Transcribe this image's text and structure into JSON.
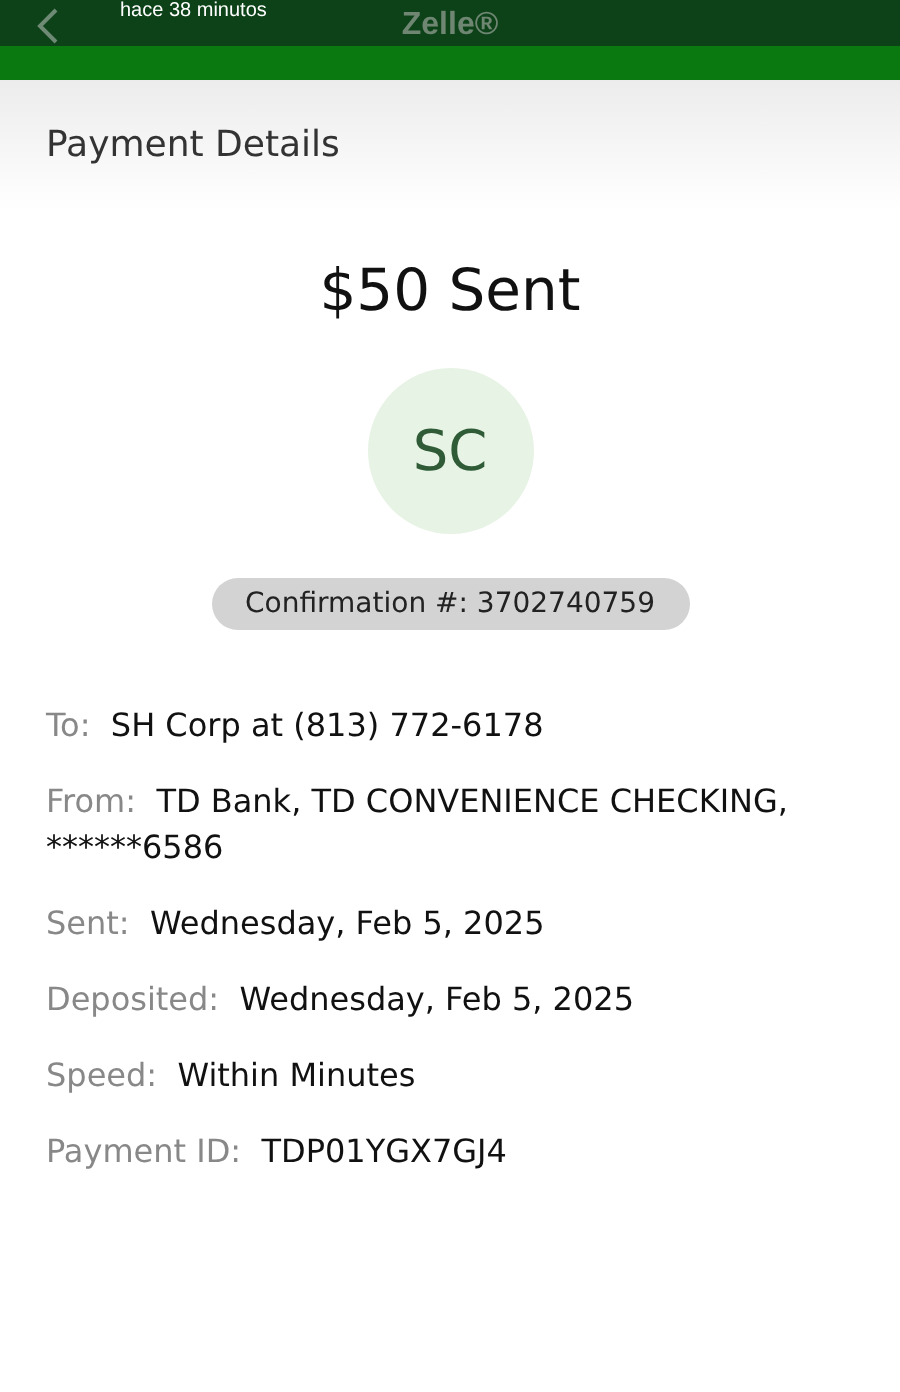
{
  "top_bar": {
    "notice": "hace 38 minutos",
    "title": "Zelle®"
  },
  "header": {
    "title": "Payment Details"
  },
  "summary": {
    "amount": "$50 Sent",
    "initials": "SC",
    "confirmation": "Confirmation #: 3702740759"
  },
  "details": [
    {
      "label": "To:",
      "value": "SH Corp at (813) 772-6178"
    },
    {
      "label": "From:",
      "value": "TD Bank, TD CONVENIENCE CHECKING, ******6586"
    },
    {
      "label": "Sent:",
      "value": "Wednesday, Feb 5, 2025"
    },
    {
      "label": "Deposited:",
      "value": "Wednesday, Feb 5, 2025"
    },
    {
      "label": "Speed:",
      "value": "Within Minutes"
    },
    {
      "label": "Payment ID:",
      "value": "TDP01YGX7GJ4"
    }
  ]
}
